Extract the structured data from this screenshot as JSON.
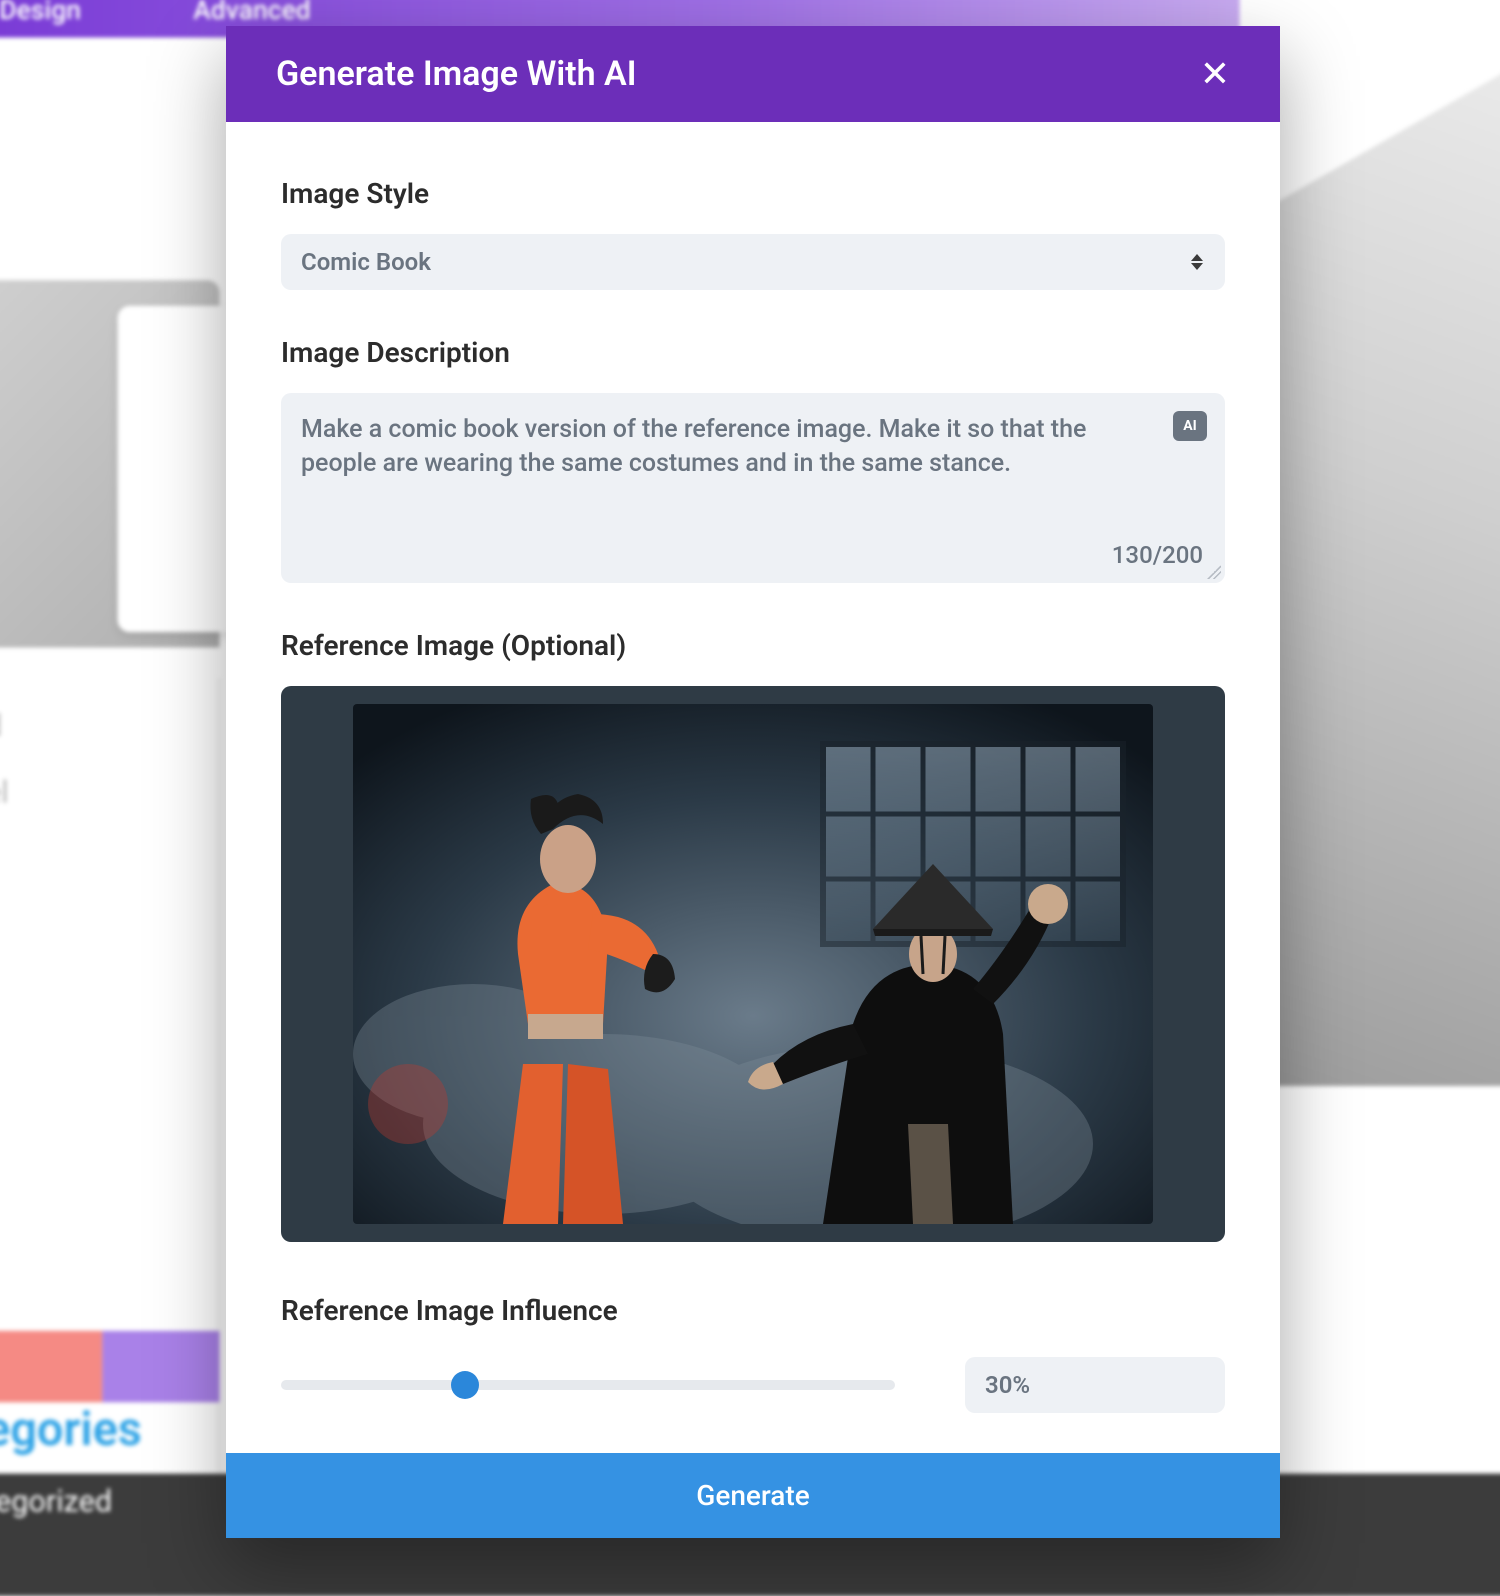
{
  "background": {
    "tabs": [
      "Design",
      "Advanced"
    ],
    "side_items": [
      "d",
      "el"
    ],
    "categories_heading": "egories",
    "uncategorized": "tegorized"
  },
  "modal": {
    "title": "Generate Image With AI",
    "close_glyph": "✕",
    "style_label": "Image Style",
    "style_value": "Comic Book",
    "desc_label": "Image Description",
    "desc_value": "Make a comic book version of the reference image. Make it so that the people are wearing the same costumes and in the same stance.",
    "ai_badge": "AI",
    "char_count": "130/200",
    "ref_label": "Reference Image (Optional)",
    "influence_label": "Reference Image Influence",
    "influence_percent": 30,
    "influence_display": "30%",
    "generate_label": "Generate"
  }
}
